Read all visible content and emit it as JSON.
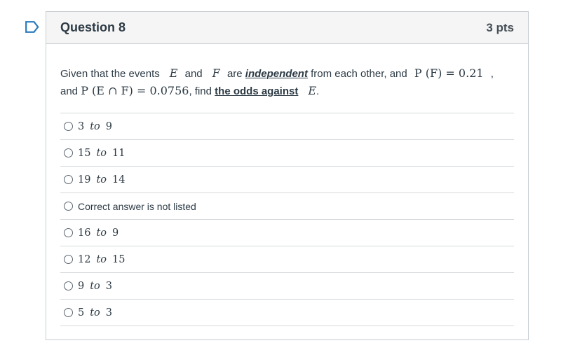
{
  "question": {
    "title": "Question 8",
    "points": "3 pts",
    "text": {
      "p1": "Given that the events",
      "var_e": "E",
      "and1": "and",
      "var_f": "F",
      "are": "are",
      "independent": "independent",
      "p2": "from each other, and",
      "pf": "P (F) = 0.21",
      "comma": ",",
      "and2": "and",
      "pef": "P (E ∩ F) = 0.0756",
      "find": ", find",
      "odds_against": "the odds against",
      "var_e2": "E",
      "period": "."
    }
  },
  "answers": [
    {
      "a": "3",
      "to": "to",
      "b": "9"
    },
    {
      "a": "15",
      "to": "to",
      "b": "11"
    },
    {
      "a": "19",
      "to": "to",
      "b": "14"
    },
    {
      "text": "Correct answer is not listed"
    },
    {
      "a": "16",
      "to": "to",
      "b": "9"
    },
    {
      "a": "12",
      "to": "to",
      "b": "15"
    },
    {
      "a": "9",
      "to": "to",
      "b": "3"
    },
    {
      "a": "5",
      "to": "to",
      "b": "3"
    }
  ],
  "colors": {
    "flag": "#2b7abc",
    "border": "#c7cdd1",
    "header_bg": "#f5f5f5",
    "text": "#2d3b45"
  },
  "icons": {
    "flag": "bookmark-flag-icon",
    "radio": "radio-button"
  }
}
